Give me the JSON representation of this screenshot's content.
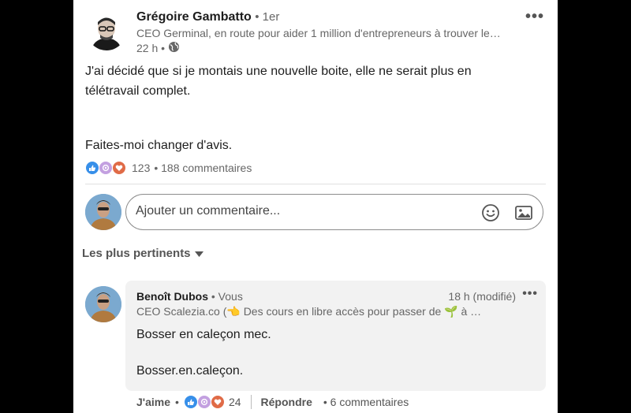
{
  "post": {
    "author": {
      "name": "Grégoire Gambatto",
      "degree": "• 1er",
      "headline": "CEO Germinal, en route pour aider 1 million d'entrepreneurs à trouver le…",
      "time": "22 h •"
    },
    "text": {
      "line1": "J'ai décidé que si je montais une nouvelle boite, elle ne serait plus en",
      "line2": "télétravail complet.",
      "line3": "Faites-moi changer d'avis."
    },
    "reactions": {
      "count": "123",
      "comments": "• 188 commentaires"
    }
  },
  "comment_box": {
    "placeholder": "Ajouter un commentaire..."
  },
  "sort": {
    "label": "Les plus pertinents"
  },
  "comment": {
    "author": "Benoît Dubos",
    "you": " • Vous",
    "time": "18 h (modifié)",
    "headline": "CEO Scalezia.co (👈 Des cours en libre accès pour passer de 🌱 à …",
    "text1": "Bosser en caleçon mec.",
    "text2": "Bosser.en.caleçon.",
    "actions": {
      "like": "J'aime",
      "dot": "•",
      "reaction_count": "24",
      "reply": "Répondre",
      "replies": "• 6 commentaires"
    }
  },
  "colors": {
    "like": "#378fe9",
    "support": "#c3a0e0",
    "love": "#e06b47",
    "bubble": "#f2f2f2"
  },
  "icons": [
    "globe-icon",
    "more-icon",
    "emoji-icon",
    "image-icon",
    "caret-down-icon",
    "like-reaction-icon",
    "support-reaction-icon",
    "love-reaction-icon"
  ]
}
